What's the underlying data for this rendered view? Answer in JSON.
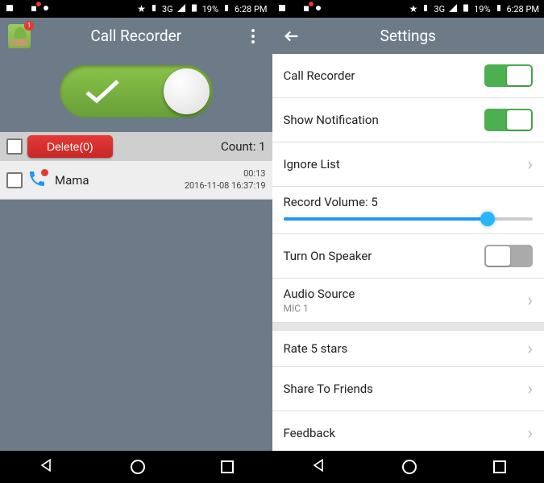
{
  "statusbar": {
    "signal": "3G",
    "battery": "19%",
    "time": "6:28 PM"
  },
  "left_pane": {
    "app_badge": "1",
    "title": "Call Recorder",
    "master_toggle_on": true,
    "delete_label": "Delete(0)",
    "count_label": "Count: 1",
    "recordings": [
      {
        "name": "Mama",
        "duration": "00:13",
        "timestamp": "2016-11-08 16:37:19"
      }
    ]
  },
  "right_pane": {
    "title": "Settings",
    "items": {
      "call_recorder": {
        "label": "Call Recorder",
        "on": true
      },
      "show_notification": {
        "label": "Show Notification",
        "on": true
      },
      "ignore_list": {
        "label": "Ignore List"
      },
      "record_volume": {
        "label": "Record Volume: 5",
        "value": 5,
        "max": 6
      },
      "turn_on_speaker": {
        "label": "Turn On Speaker",
        "on": false
      },
      "audio_source": {
        "label": "Audio Source",
        "value": "MIC 1"
      },
      "rate": {
        "label": "Rate 5 stars"
      },
      "share": {
        "label": "Share To Friends"
      },
      "feedback": {
        "label": "Feedback"
      }
    }
  }
}
